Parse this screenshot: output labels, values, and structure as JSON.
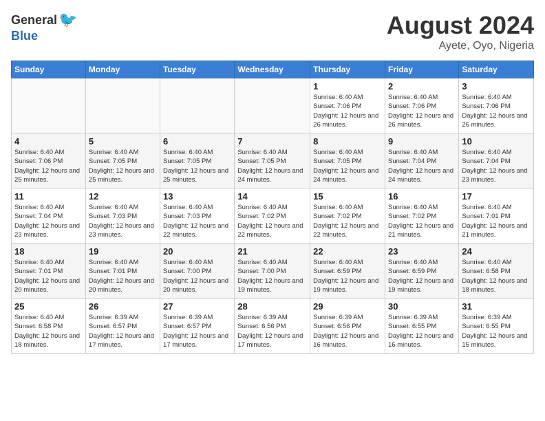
{
  "header": {
    "logo_general": "General",
    "logo_blue": "Blue",
    "month": "August 2024",
    "location": "Ayete, Oyo, Nigeria"
  },
  "weekdays": [
    "Sunday",
    "Monday",
    "Tuesday",
    "Wednesday",
    "Thursday",
    "Friday",
    "Saturday"
  ],
  "weeks": [
    [
      {
        "day": "",
        "info": ""
      },
      {
        "day": "",
        "info": ""
      },
      {
        "day": "",
        "info": ""
      },
      {
        "day": "",
        "info": ""
      },
      {
        "day": "1",
        "info": "Sunrise: 6:40 AM\nSunset: 7:06 PM\nDaylight: 12 hours\nand 26 minutes."
      },
      {
        "day": "2",
        "info": "Sunrise: 6:40 AM\nSunset: 7:06 PM\nDaylight: 12 hours\nand 26 minutes."
      },
      {
        "day": "3",
        "info": "Sunrise: 6:40 AM\nSunset: 7:06 PM\nDaylight: 12 hours\nand 26 minutes."
      }
    ],
    [
      {
        "day": "4",
        "info": "Sunrise: 6:40 AM\nSunset: 7:06 PM\nDaylight: 12 hours\nand 25 minutes."
      },
      {
        "day": "5",
        "info": "Sunrise: 6:40 AM\nSunset: 7:05 PM\nDaylight: 12 hours\nand 25 minutes."
      },
      {
        "day": "6",
        "info": "Sunrise: 6:40 AM\nSunset: 7:05 PM\nDaylight: 12 hours\nand 25 minutes."
      },
      {
        "day": "7",
        "info": "Sunrise: 6:40 AM\nSunset: 7:05 PM\nDaylight: 12 hours\nand 24 minutes."
      },
      {
        "day": "8",
        "info": "Sunrise: 6:40 AM\nSunset: 7:05 PM\nDaylight: 12 hours\nand 24 minutes."
      },
      {
        "day": "9",
        "info": "Sunrise: 6:40 AM\nSunset: 7:04 PM\nDaylight: 12 hours\nand 24 minutes."
      },
      {
        "day": "10",
        "info": "Sunrise: 6:40 AM\nSunset: 7:04 PM\nDaylight: 12 hours\nand 23 minutes."
      }
    ],
    [
      {
        "day": "11",
        "info": "Sunrise: 6:40 AM\nSunset: 7:04 PM\nDaylight: 12 hours\nand 23 minutes."
      },
      {
        "day": "12",
        "info": "Sunrise: 6:40 AM\nSunset: 7:03 PM\nDaylight: 12 hours\nand 23 minutes."
      },
      {
        "day": "13",
        "info": "Sunrise: 6:40 AM\nSunset: 7:03 PM\nDaylight: 12 hours\nand 22 minutes."
      },
      {
        "day": "14",
        "info": "Sunrise: 6:40 AM\nSunset: 7:02 PM\nDaylight: 12 hours\nand 22 minutes."
      },
      {
        "day": "15",
        "info": "Sunrise: 6:40 AM\nSunset: 7:02 PM\nDaylight: 12 hours\nand 22 minutes."
      },
      {
        "day": "16",
        "info": "Sunrise: 6:40 AM\nSunset: 7:02 PM\nDaylight: 12 hours\nand 21 minutes."
      },
      {
        "day": "17",
        "info": "Sunrise: 6:40 AM\nSunset: 7:01 PM\nDaylight: 12 hours\nand 21 minutes."
      }
    ],
    [
      {
        "day": "18",
        "info": "Sunrise: 6:40 AM\nSunset: 7:01 PM\nDaylight: 12 hours\nand 20 minutes."
      },
      {
        "day": "19",
        "info": "Sunrise: 6:40 AM\nSunset: 7:01 PM\nDaylight: 12 hours\nand 20 minutes."
      },
      {
        "day": "20",
        "info": "Sunrise: 6:40 AM\nSunset: 7:00 PM\nDaylight: 12 hours\nand 20 minutes."
      },
      {
        "day": "21",
        "info": "Sunrise: 6:40 AM\nSunset: 7:00 PM\nDaylight: 12 hours\nand 19 minutes."
      },
      {
        "day": "22",
        "info": "Sunrise: 6:40 AM\nSunset: 6:59 PM\nDaylight: 12 hours\nand 19 minutes."
      },
      {
        "day": "23",
        "info": "Sunrise: 6:40 AM\nSunset: 6:59 PM\nDaylight: 12 hours\nand 19 minutes."
      },
      {
        "day": "24",
        "info": "Sunrise: 6:40 AM\nSunset: 6:58 PM\nDaylight: 12 hours\nand 18 minutes."
      }
    ],
    [
      {
        "day": "25",
        "info": "Sunrise: 6:40 AM\nSunset: 6:58 PM\nDaylight: 12 hours\nand 18 minutes."
      },
      {
        "day": "26",
        "info": "Sunrise: 6:39 AM\nSunset: 6:57 PM\nDaylight: 12 hours\nand 17 minutes."
      },
      {
        "day": "27",
        "info": "Sunrise: 6:39 AM\nSunset: 6:57 PM\nDaylight: 12 hours\nand 17 minutes."
      },
      {
        "day": "28",
        "info": "Sunrise: 6:39 AM\nSunset: 6:56 PM\nDaylight: 12 hours\nand 17 minutes."
      },
      {
        "day": "29",
        "info": "Sunrise: 6:39 AM\nSunset: 6:56 PM\nDaylight: 12 hours\nand 16 minutes."
      },
      {
        "day": "30",
        "info": "Sunrise: 6:39 AM\nSunset: 6:55 PM\nDaylight: 12 hours\nand 16 minutes."
      },
      {
        "day": "31",
        "info": "Sunrise: 6:39 AM\nSunset: 6:55 PM\nDaylight: 12 hours\nand 15 minutes."
      }
    ]
  ]
}
